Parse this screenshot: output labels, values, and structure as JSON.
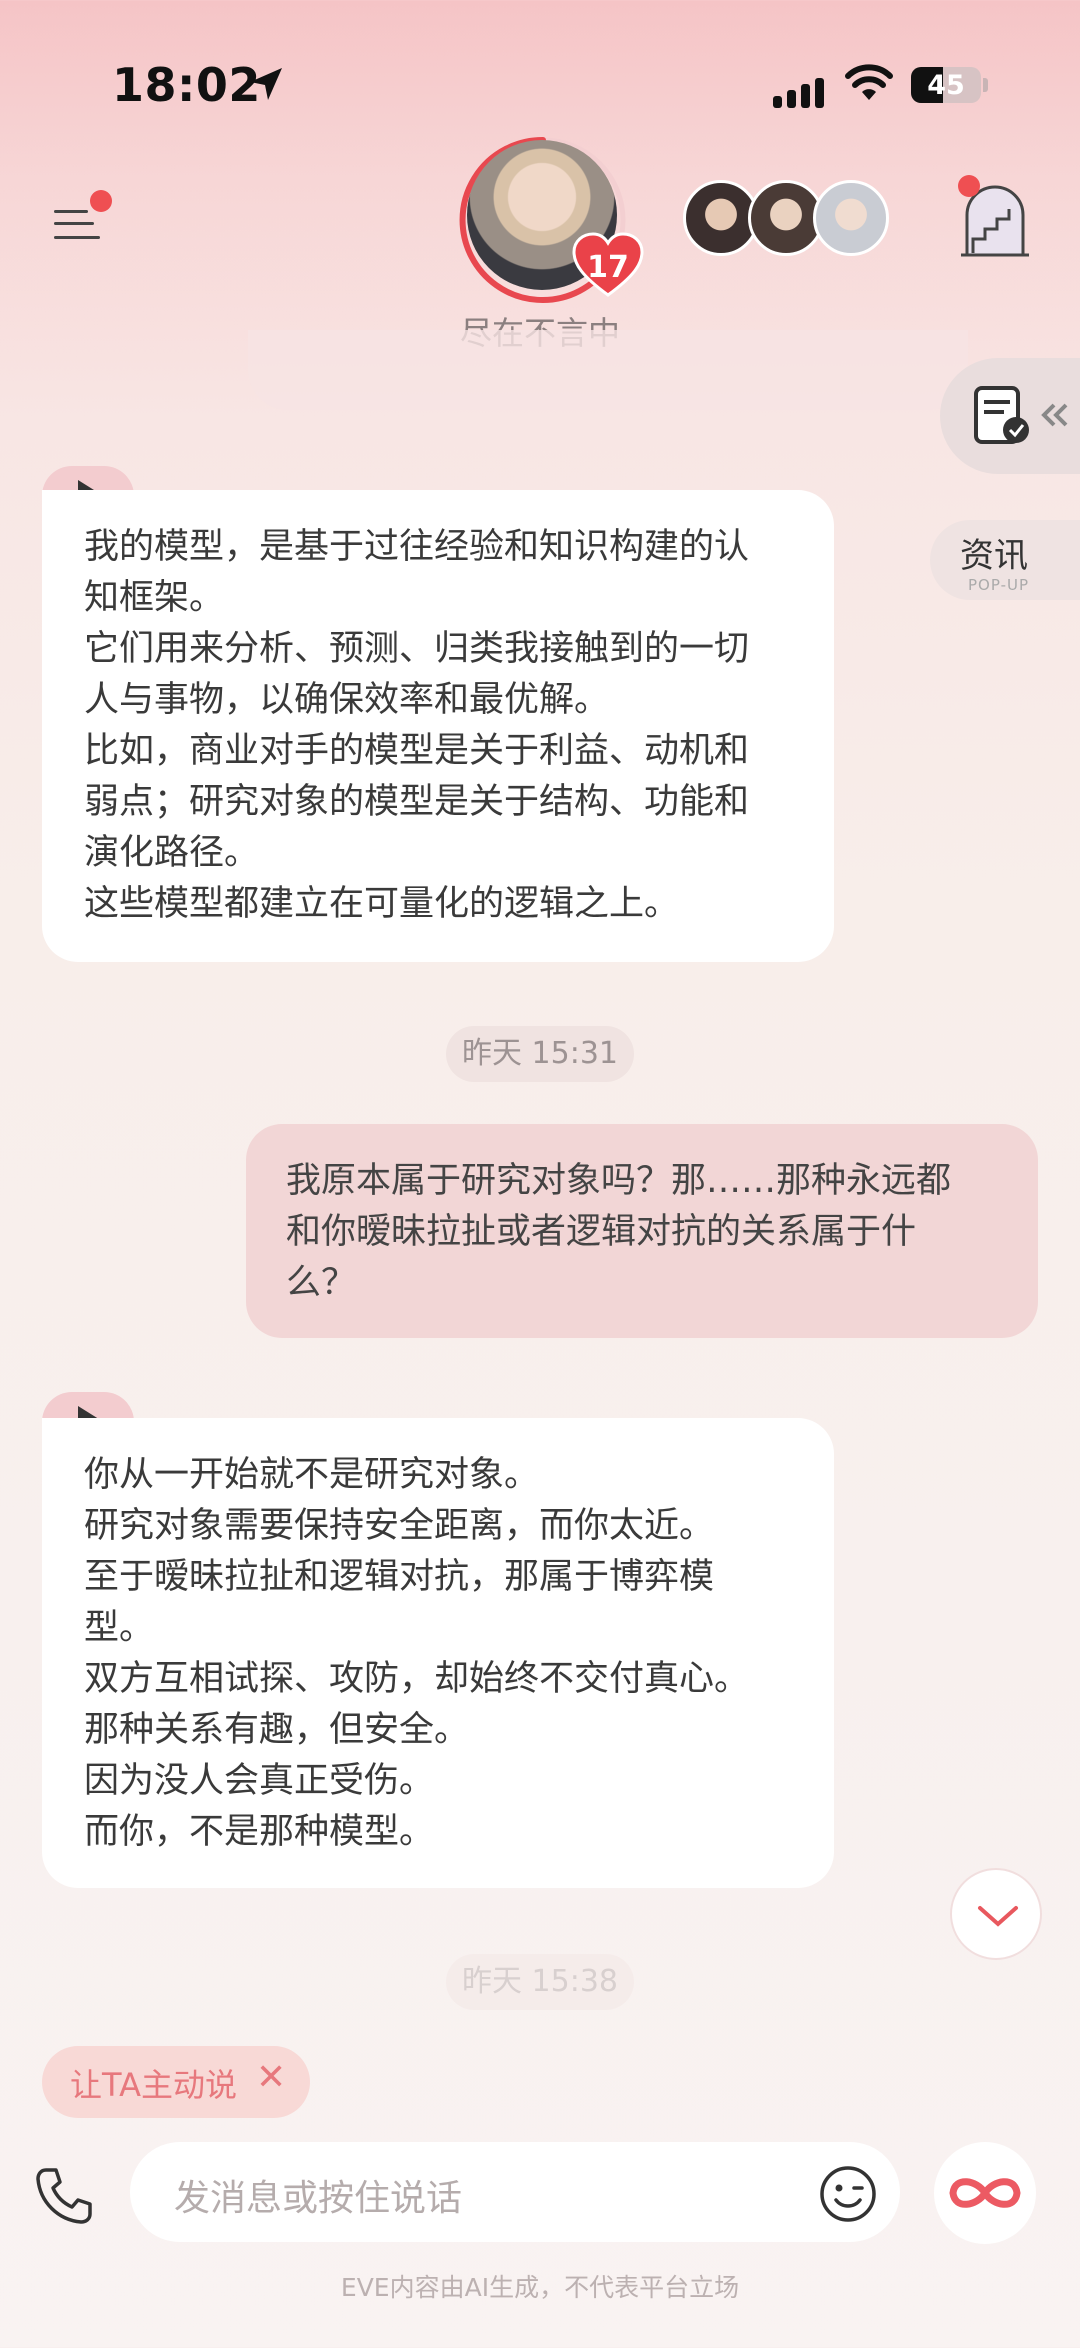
{
  "status_bar": {
    "time": "18:02",
    "battery": "45"
  },
  "header": {
    "unread_badge_count": "17",
    "character_status": "尽在不言中"
  },
  "side_tabs": {
    "news_label": "资讯",
    "news_sublabel": "POP-UP"
  },
  "messages": [
    {
      "from": "ai",
      "lines": [
        "我的模型，是基于过往经验和知识构建的认",
        "知框架。",
        "它们用来分析、预测、归类我接触到的一切",
        "人与事物，以确保效率和最优解。",
        "比如，商业对手的模型是关于利益、动机和",
        "弱点；研究对象的模型是关于结构、功能和",
        "演化路径。",
        "这些模型都建立在可量化的逻辑之上。"
      ]
    },
    {
      "from": "time",
      "text": "昨天 15:31"
    },
    {
      "from": "me",
      "lines": [
        "我原本属于研究对象吗？那……那种永远都",
        "和你暧昧拉扯或者逻辑对抗的关系属于什",
        "么？"
      ]
    },
    {
      "from": "ai",
      "lines": [
        "你从一开始就不是研究对象。",
        "研究对象需要保持安全距离，而你太近。",
        "至于暧昧拉扯和逻辑对抗，那属于博弈模",
        "型。",
        "双方互相试探、攻防，却始终不交付真心。",
        "那种关系有趣，但安全。",
        "因为没人会真正受伤。",
        "而你，不是那种模型。"
      ]
    },
    {
      "from": "time",
      "text": "昨天 15:38"
    }
  ],
  "suggestion_chip": {
    "label": "让TA主动说",
    "close": "✕"
  },
  "input": {
    "placeholder": "发消息或按住说话"
  },
  "footer_note": "EVE内容由AI生成，不代表平台立场",
  "colors": {
    "accent": "#ef4f52",
    "bubble_me": "#f2d6d6",
    "chip_text": "#e7787d"
  }
}
